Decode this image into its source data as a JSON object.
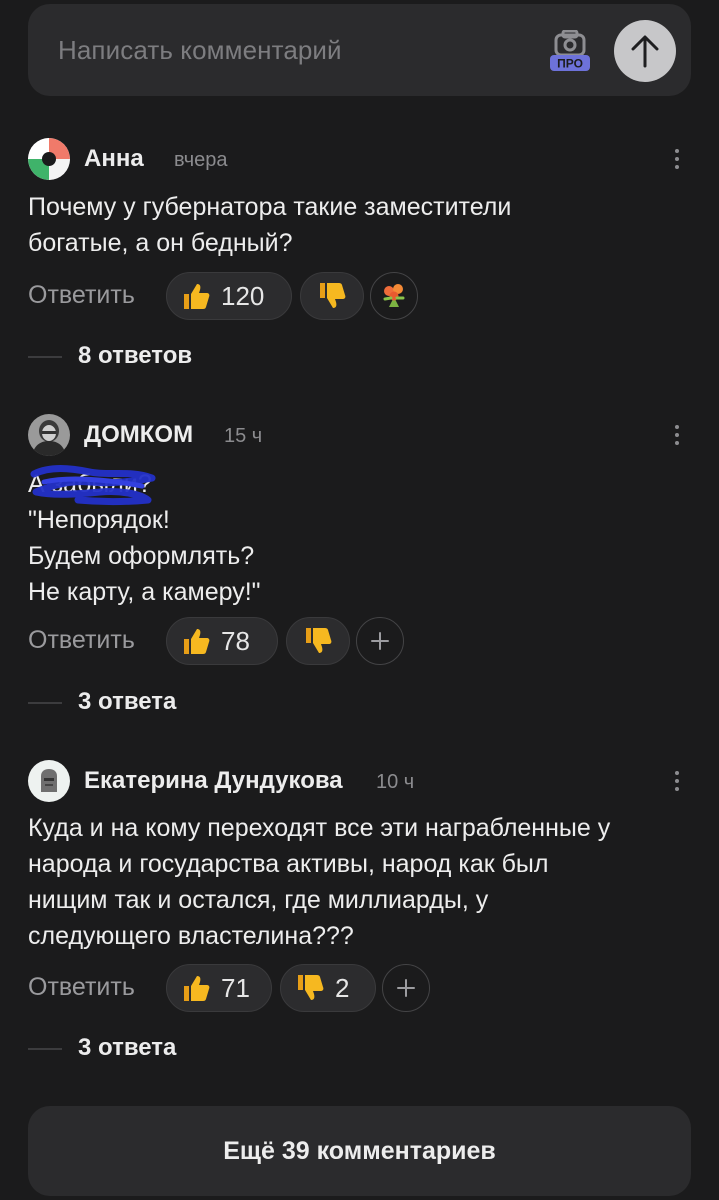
{
  "composer": {
    "placeholder": "Написать комментарий",
    "pro_badge": "ПРО"
  },
  "comments": [
    {
      "author": "Анна",
      "time": "вчера",
      "lines": [
        "Почему у губернатора такие заместители",
        "богатые, а он бедный?"
      ],
      "reply_label": "Ответить",
      "likes": "120",
      "dislikes": "",
      "extra_reaction": "bouquet-icon",
      "replies_label": "8 ответов"
    },
    {
      "author": "ДОМКОМ",
      "time": "15 ч",
      "lines": [
        "А     забыли?",
        "\"Непорядок!",
        "Будем оформлять?",
        "Не карту, а камеру!\""
      ],
      "reply_label": "Ответить",
      "likes": "78",
      "dislikes": "",
      "extra_reaction": "add-reaction-icon",
      "replies_label": "3 ответа"
    },
    {
      "author": "Екатерина Дундукова",
      "time": "10 ч",
      "lines": [
        "Куда и на кому переходят все эти награбленные у",
        "народа и государства активы, народ как был",
        "нищим так и остался, где миллиарды, у",
        "следующего властелина???"
      ],
      "reply_label": "Ответить",
      "likes": "71",
      "dislikes": "2",
      "extra_reaction": "add-reaction-icon",
      "replies_label": "3 ответа"
    }
  ],
  "load_more": "Ещё 39 комментариев",
  "colors": {
    "background": "#1b1b1c",
    "surface": "#2b2b2d",
    "pro_accent": "#6d72d9",
    "thumb_yellow": "#f6b820"
  }
}
